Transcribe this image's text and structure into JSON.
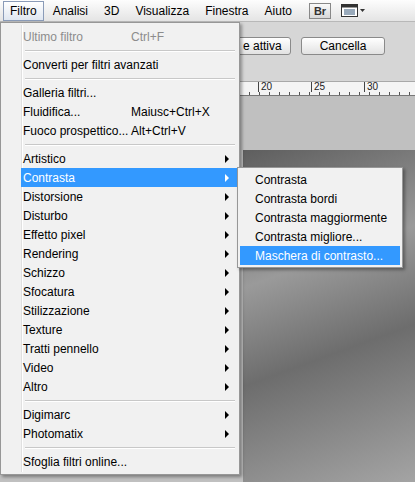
{
  "menubar": {
    "items": [
      {
        "label": "Filtro",
        "selected": true
      },
      {
        "label": "Analisi",
        "selected": false
      },
      {
        "label": "3D",
        "selected": false
      },
      {
        "label": "Visualizza",
        "selected": false
      },
      {
        "label": "Finestra",
        "selected": false
      },
      {
        "label": "Aiuto",
        "selected": false
      }
    ],
    "bridge": "Br"
  },
  "options_bar": {
    "buttons": [
      "e attiva",
      "Cancella"
    ]
  },
  "ruler": {
    "ticks": [
      "20",
      "25",
      "30"
    ]
  },
  "menu": {
    "items": [
      {
        "kind": "item",
        "label": "Ultimo filtro",
        "shortcut": "Ctrl+F",
        "disabled": true,
        "submenu": false,
        "selected": false
      },
      {
        "kind": "separator"
      },
      {
        "kind": "item",
        "label": "Converti per filtri avanzati",
        "shortcut": "",
        "disabled": false,
        "submenu": false,
        "selected": false
      },
      {
        "kind": "separator"
      },
      {
        "kind": "item",
        "label": "Galleria filtri...",
        "shortcut": "",
        "disabled": false,
        "submenu": false,
        "selected": false
      },
      {
        "kind": "item",
        "label": "Fluidifica...",
        "shortcut": "Maiusc+Ctrl+X",
        "disabled": false,
        "submenu": false,
        "selected": false
      },
      {
        "kind": "item",
        "label": "Fuoco prospettico...",
        "shortcut": "Alt+Ctrl+V",
        "disabled": false,
        "submenu": false,
        "selected": false
      },
      {
        "kind": "separator"
      },
      {
        "kind": "item",
        "label": "Artistico",
        "shortcut": "",
        "disabled": false,
        "submenu": true,
        "selected": false
      },
      {
        "kind": "item",
        "label": "Contrasta",
        "shortcut": "",
        "disabled": false,
        "submenu": true,
        "selected": true
      },
      {
        "kind": "item",
        "label": "Distorsione",
        "shortcut": "",
        "disabled": false,
        "submenu": true,
        "selected": false
      },
      {
        "kind": "item",
        "label": "Disturbo",
        "shortcut": "",
        "disabled": false,
        "submenu": true,
        "selected": false
      },
      {
        "kind": "item",
        "label": "Effetto pixel",
        "shortcut": "",
        "disabled": false,
        "submenu": true,
        "selected": false
      },
      {
        "kind": "item",
        "label": "Rendering",
        "shortcut": "",
        "disabled": false,
        "submenu": true,
        "selected": false
      },
      {
        "kind": "item",
        "label": "Schizzo",
        "shortcut": "",
        "disabled": false,
        "submenu": true,
        "selected": false
      },
      {
        "kind": "item",
        "label": "Sfocatura",
        "shortcut": "",
        "disabled": false,
        "submenu": true,
        "selected": false
      },
      {
        "kind": "item",
        "label": "Stilizzazione",
        "shortcut": "",
        "disabled": false,
        "submenu": true,
        "selected": false
      },
      {
        "kind": "item",
        "label": "Texture",
        "shortcut": "",
        "disabled": false,
        "submenu": true,
        "selected": false
      },
      {
        "kind": "item",
        "label": "Tratti pennello",
        "shortcut": "",
        "disabled": false,
        "submenu": true,
        "selected": false
      },
      {
        "kind": "item",
        "label": "Video",
        "shortcut": "",
        "disabled": false,
        "submenu": true,
        "selected": false
      },
      {
        "kind": "item",
        "label": "Altro",
        "shortcut": "",
        "disabled": false,
        "submenu": true,
        "selected": false
      },
      {
        "kind": "separator"
      },
      {
        "kind": "item",
        "label": "Digimarc",
        "shortcut": "",
        "disabled": false,
        "submenu": true,
        "selected": false
      },
      {
        "kind": "item",
        "label": "Photomatix",
        "shortcut": "",
        "disabled": false,
        "submenu": true,
        "selected": false
      },
      {
        "kind": "separator"
      },
      {
        "kind": "item",
        "label": "Sfoglia filtri online...",
        "shortcut": "",
        "disabled": false,
        "submenu": false,
        "selected": false
      }
    ]
  },
  "submenu": {
    "items": [
      {
        "label": "Contrasta",
        "selected": false
      },
      {
        "label": "Contrasta bordi",
        "selected": false
      },
      {
        "label": "Contrasta maggiormente",
        "selected": false
      },
      {
        "label": "Contrasta migliore...",
        "selected": false
      },
      {
        "label": "Maschera di contrasto...",
        "selected": true
      }
    ]
  }
}
